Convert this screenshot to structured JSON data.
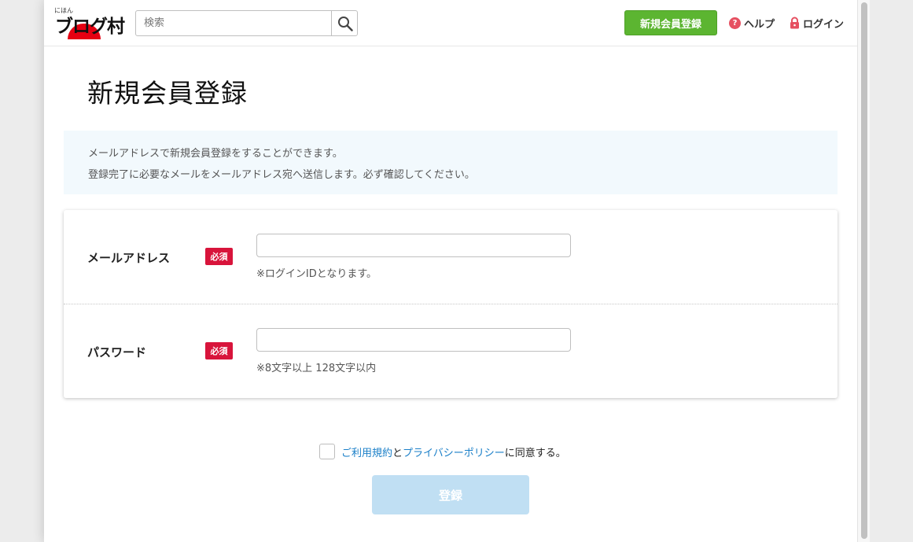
{
  "header": {
    "logo": {
      "ruby": "にほん",
      "text": "ブログ村"
    },
    "search": {
      "placeholder": "検索"
    },
    "register_label": "新規会員登録",
    "help_label": "ヘルプ",
    "help_glyph": "?",
    "login_label": "ログイン"
  },
  "page": {
    "title": "新規会員登録"
  },
  "notice": {
    "line1": "メールアドレスで新規会員登録をすることができます。",
    "line2": "登録完了に必要なメールをメールアドレス宛へ送信します。必ず確認してください。"
  },
  "form": {
    "fields": [
      {
        "label": "メールアドレス",
        "badge": "必須",
        "value": "",
        "note": "※ログインIDとなります。"
      },
      {
        "label": "パスワード",
        "badge": "必須",
        "value": "",
        "note": "※8文字以上 128文字以内"
      }
    ],
    "agreement": {
      "terms_link": "ご利用規約",
      "and": "と",
      "privacy_link": "プライバシーポリシー",
      "suffix": "に同意する。",
      "checked": false
    },
    "submit_label": "登録"
  },
  "colors": {
    "brand_green": "#5cb531",
    "required_red": "#d8143b",
    "link_blue": "#1a7fc8",
    "submit_disabled": "#c0dff3",
    "notice_bg": "#f2f9fd"
  },
  "icons": {
    "search": "search-icon",
    "help": "help-icon",
    "lock": "lock-icon"
  }
}
